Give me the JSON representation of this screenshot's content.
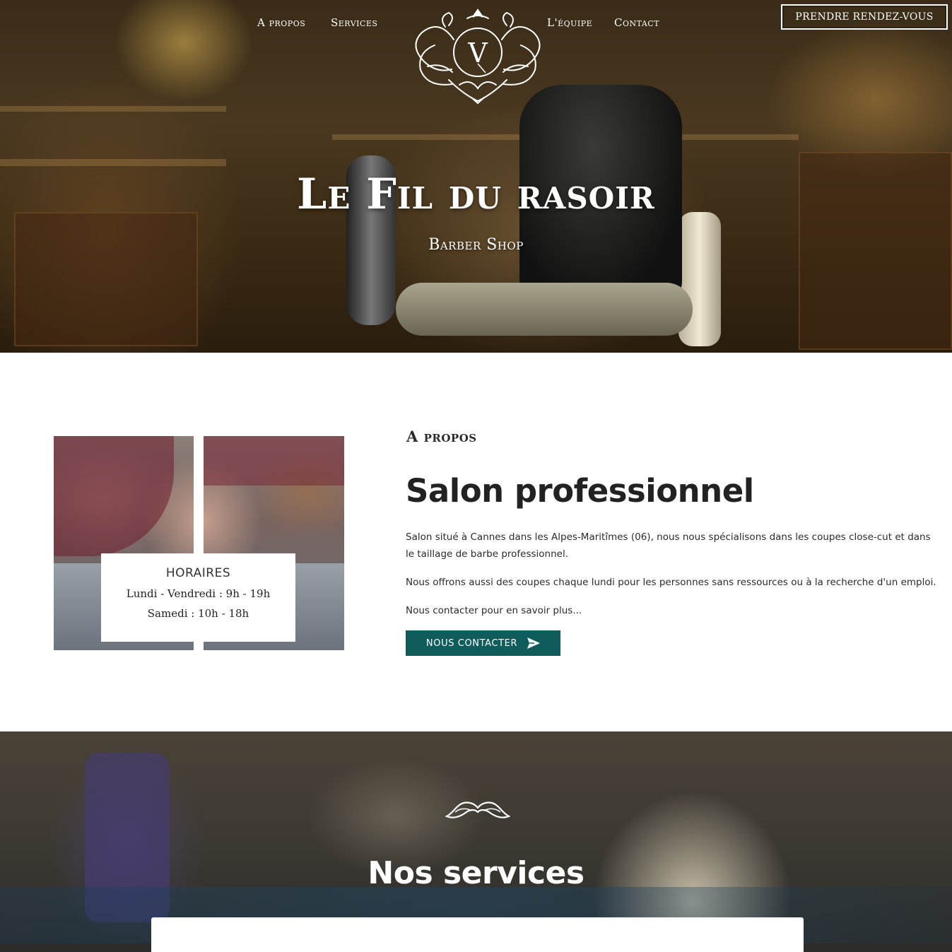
{
  "nav": {
    "about": "A propos",
    "services": "Services",
    "team": "L'équipe",
    "contact": "Contact",
    "booking_button": "PRENDRE RENDEZ-VOUS",
    "logo_letter": "V",
    "logo_icon": "ornamental-v-crest-icon"
  },
  "hero": {
    "title": "Le Fil du rasoir",
    "subtitle": "Barber Shop"
  },
  "about": {
    "eyebrow": "A propos",
    "heading": "Salon professionnel",
    "paragraphs": [
      "Salon situé à Cannes dans les Alpes-Maritîmes (06), nous nous spécialisons dans les coupes close-cut et dans le taillage de barbe professionnel.",
      "Nous offrons aussi des coupes chaque lundi pour les personnes sans ressources ou à la recherche d'un emploi.",
      "Nous contacter pour en savoir plus..."
    ],
    "button_label": "NOUS CONTACTER",
    "button_icon": "send-icon",
    "hours": {
      "title": "HORAIRES",
      "lines": [
        "Lundi - Vendredi : 9h - 19h",
        "Samedi : 10h - 18h"
      ]
    }
  },
  "services": {
    "icon": "mustache-icon",
    "title": "Nos services"
  },
  "colors": {
    "accent": "#0e5c5c",
    "text": "#222222",
    "white": "#ffffff"
  }
}
